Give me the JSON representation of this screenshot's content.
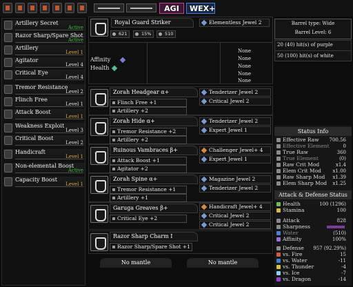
{
  "toolbar": {
    "tags": [
      "AGI",
      "WEX+"
    ]
  },
  "skills": [
    {
      "name": "Artillery Secret",
      "level": "Active",
      "state": "active"
    },
    {
      "name": "Razor Sharp/Spare Shot",
      "level": "Active",
      "state": "active"
    },
    {
      "name": "Artillery",
      "level": "Level 1",
      "state": "lv1"
    },
    {
      "name": "Agitator",
      "level": "Level 4",
      "state": "normal"
    },
    {
      "name": "Critical Eye",
      "level": "Level 4",
      "state": "normal"
    },
    {
      "name": "Tremor Resistance",
      "level": "Level 2",
      "state": "normal"
    },
    {
      "name": "Flinch Free",
      "level": "Level 1",
      "state": "normal"
    },
    {
      "name": "Attack Boost",
      "level": "Level 1",
      "state": "lv1"
    },
    {
      "name": "Weakness Exploit",
      "level": "Level 3",
      "state": "normal"
    },
    {
      "name": "Critical Boost",
      "level": "Level 2",
      "state": "normal"
    },
    {
      "name": "Handicraft",
      "level": "Level 1",
      "state": "lv1"
    },
    {
      "name": "Non-elemental Boost",
      "level": "Active",
      "state": "active"
    },
    {
      "name": "Capacity Boost",
      "level": "Level 1",
      "state": "lv1"
    }
  ],
  "weapon": {
    "name": "Royal Guard Striker",
    "attack": "621",
    "affinity": "15%",
    "defense": "510",
    "jewel": "Elementless Jewel 2",
    "affinity_label": "Affinity",
    "health_label": "Health",
    "none_label": "None"
  },
  "armor": [
    {
      "name": "Zorah Headgear α+",
      "skills": [
        "Flinch Free +1",
        "Artillery +2"
      ],
      "jewels": [
        "Tenderizer Jewel 2",
        "Critical Jewel 2"
      ]
    },
    {
      "name": "Zorah Hide α+",
      "skills": [
        "Tremor Resistance +2",
        "Artillery +2"
      ],
      "jewels": [
        "Tenderizer Jewel 2",
        "Expert Jewel 1"
      ]
    },
    {
      "name": "Ruinous Vambraces β+",
      "skills": [
        "Attack Boost +1",
        "Agitator +2"
      ],
      "jewels": [
        "Challenger Jewel+ 4",
        "Expert Jewel 1"
      ]
    },
    {
      "name": "Zorah Spine α+",
      "skills": [
        "Tremor Resistance +1",
        "Artillery +1"
      ],
      "jewels": [
        "Magazine Jewel 2",
        "Tenderizer Jewel 2"
      ]
    },
    {
      "name": "Garuga Greaves β+",
      "skills": [
        "Critical Eye +2"
      ],
      "jewels": [
        "Handicraft Jewel+ 4",
        "Critical Jewel 2",
        "Critical Jewel 2"
      ]
    },
    {
      "name": "Razor Sharp Charm I",
      "skills": [
        "Razor Sharp/Spare Shot +1"
      ],
      "jewels": []
    }
  ],
  "mantles": [
    "No mantle",
    "No mantle"
  ],
  "barrel": {
    "type": "Barrel type: Wide",
    "level": "Barrel Level: 6",
    "purple": "20 (40) hit(s) of purple",
    "white": "50 (100) hit(s) of white"
  },
  "status": {
    "header": "Status Info",
    "rows": [
      {
        "label": "Effective Raw",
        "value": "700.56",
        "dim": false
      },
      {
        "label": "Effective Element",
        "value": "0",
        "dim": true
      },
      {
        "label": "True Raw",
        "value": "360",
        "dim": false
      },
      {
        "label": "True Element",
        "value": "(0)",
        "dim": true
      },
      {
        "label": "Raw Crit Mod",
        "value": "x1.4",
        "dim": false
      },
      {
        "label": "Elem Crit Mod",
        "value": "x1.00",
        "dim": false
      },
      {
        "label": "Raw Sharp Mod",
        "value": "x1.39",
        "dim": false
      },
      {
        "label": "Elem Sharp Mod",
        "value": "x1.25",
        "dim": false
      }
    ]
  },
  "attack_defense": {
    "header": "Attack & Defense Status",
    "rows": [
      {
        "label": "Health",
        "value": "100 (1296)"
      },
      {
        "label": "Stamina",
        "value": "100"
      },
      {
        "label": "Attack",
        "value": "828"
      },
      {
        "label": "Sharpness",
        "value": ""
      },
      {
        "label": "Water",
        "value": "(510)"
      },
      {
        "label": "Affinity",
        "value": "100%"
      },
      {
        "label": "Defense",
        "value": "957 (92.29%)"
      },
      {
        "label": "vs. Fire",
        "value": "15"
      },
      {
        "label": "vs. Water",
        "value": "-11"
      },
      {
        "label": "vs. Thunder",
        "value": "-4"
      },
      {
        "label": "vs. Ice",
        "value": "-7"
      },
      {
        "label": "vs. Dragon",
        "value": "-14"
      }
    ]
  }
}
